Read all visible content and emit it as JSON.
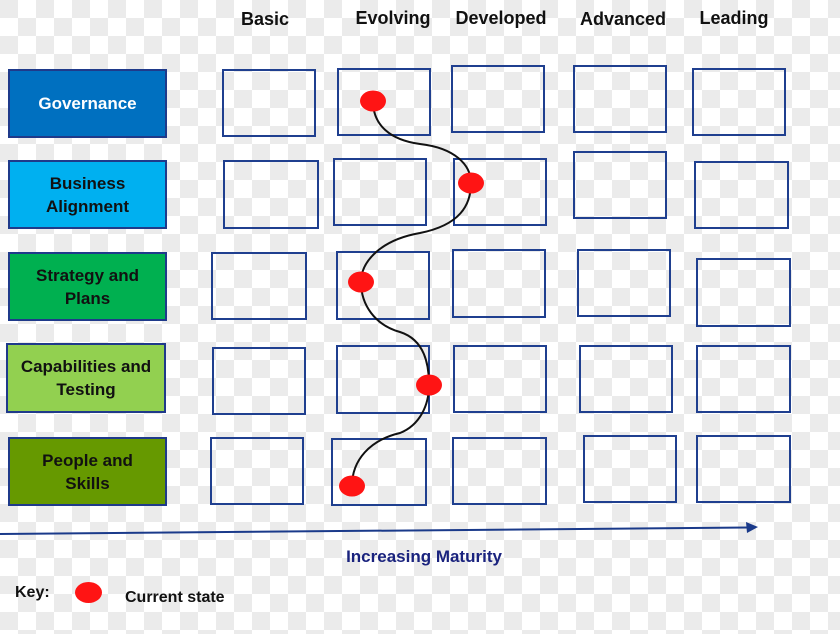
{
  "columns": [
    "Basic",
    "Evolving",
    "Developed",
    "Advanced",
    "Leading"
  ],
  "rows": [
    {
      "label": "Governance",
      "color": "#0070c0",
      "text_color": "#ffffff",
      "current_level": "Evolving"
    },
    {
      "label": "Business Alignment",
      "color": "#00b0f0",
      "text_color": "#111111",
      "current_level": "Developed"
    },
    {
      "label": "Strategy and Plans",
      "color": "#00b050",
      "text_color": "#111111",
      "current_level": "Evolving"
    },
    {
      "label": "Capabilities and Testing",
      "color": "#92d050",
      "text_color": "#111111",
      "current_level": "Evolving-Developed"
    },
    {
      "label": "People and Skills",
      "color": "#669900",
      "text_color": "#111111",
      "current_level": "Evolving"
    }
  ],
  "axis": {
    "label": "Increasing Maturity",
    "color": "#1a3a8a"
  },
  "key": {
    "label": "Key:",
    "marker_label": "Current state",
    "marker_color": "#ff1414"
  },
  "colors": {
    "cell_border": "#1f3f8f",
    "path": "#111111"
  }
}
